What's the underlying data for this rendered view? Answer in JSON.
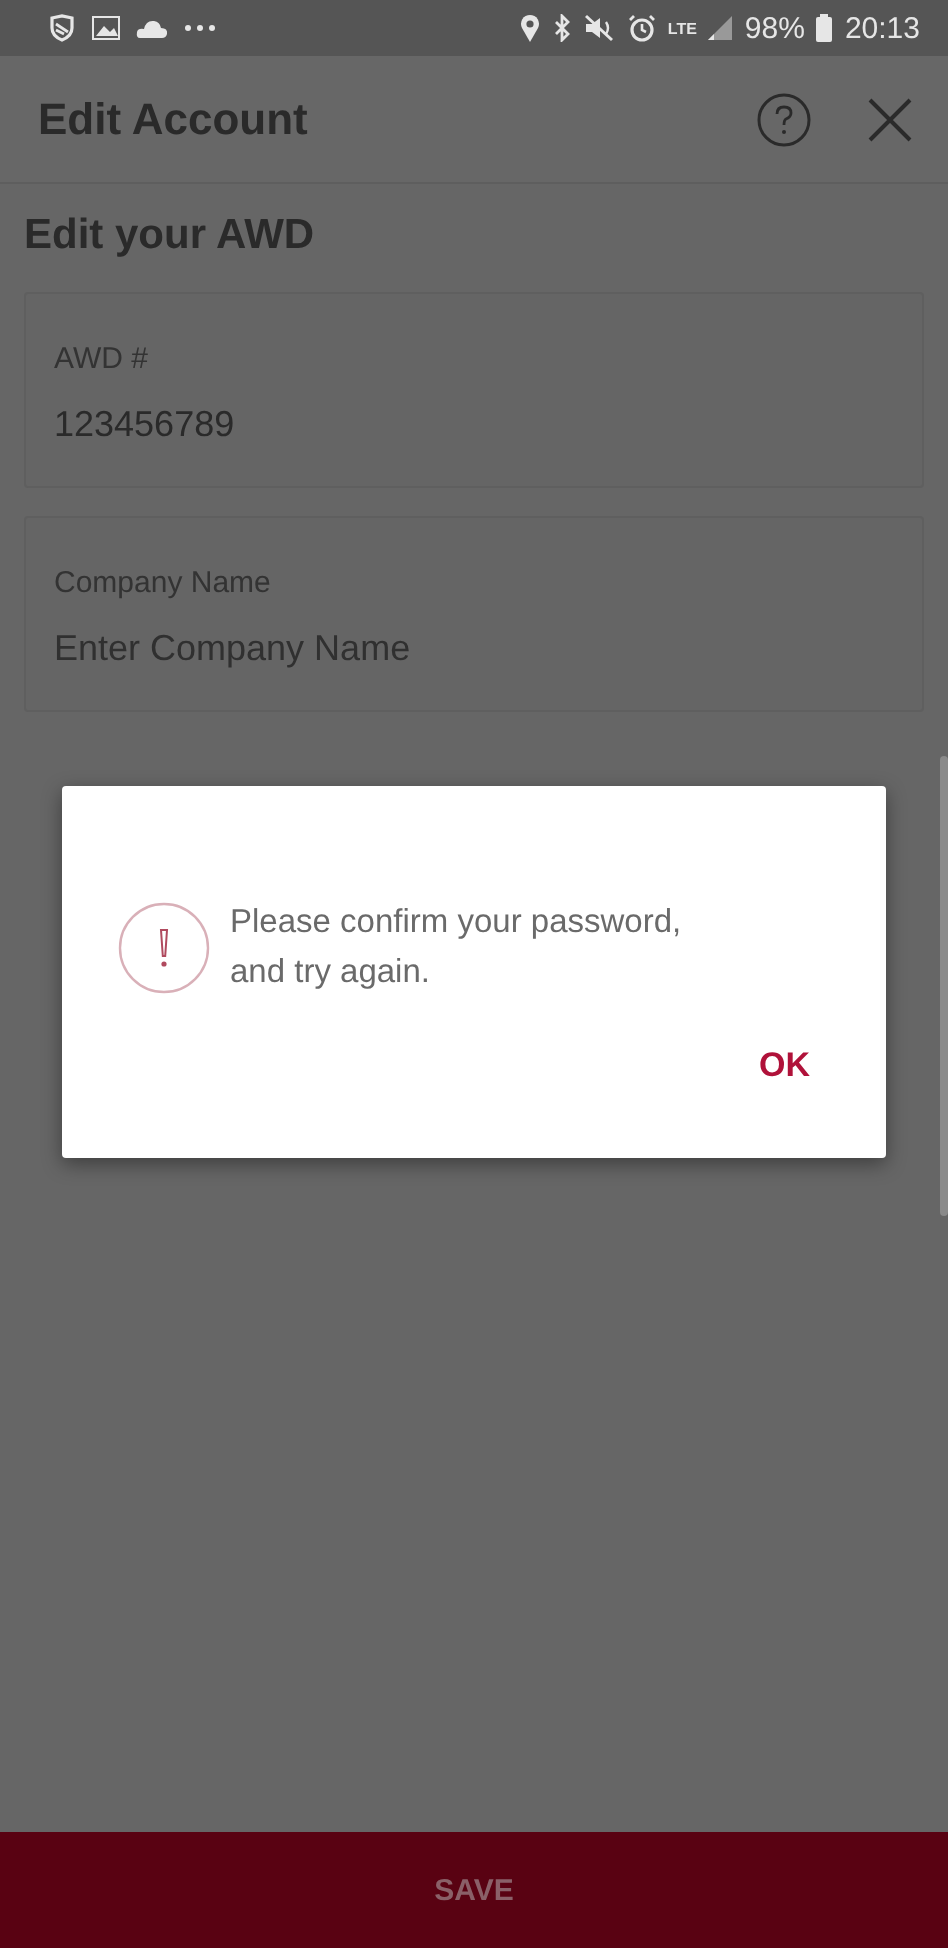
{
  "status_bar": {
    "network": "LTE",
    "battery": "98%",
    "time": "20:13"
  },
  "header": {
    "title": "Edit Account"
  },
  "section_title": "Edit your AWD",
  "fields": [
    {
      "label": "AWD #",
      "value": "123456789"
    },
    {
      "label": "Company Name",
      "placeholder": "Enter Company Name"
    }
  ],
  "dialog": {
    "message": "Please confirm your password, and try again.",
    "button": "OK"
  },
  "save_button": "SAVE"
}
